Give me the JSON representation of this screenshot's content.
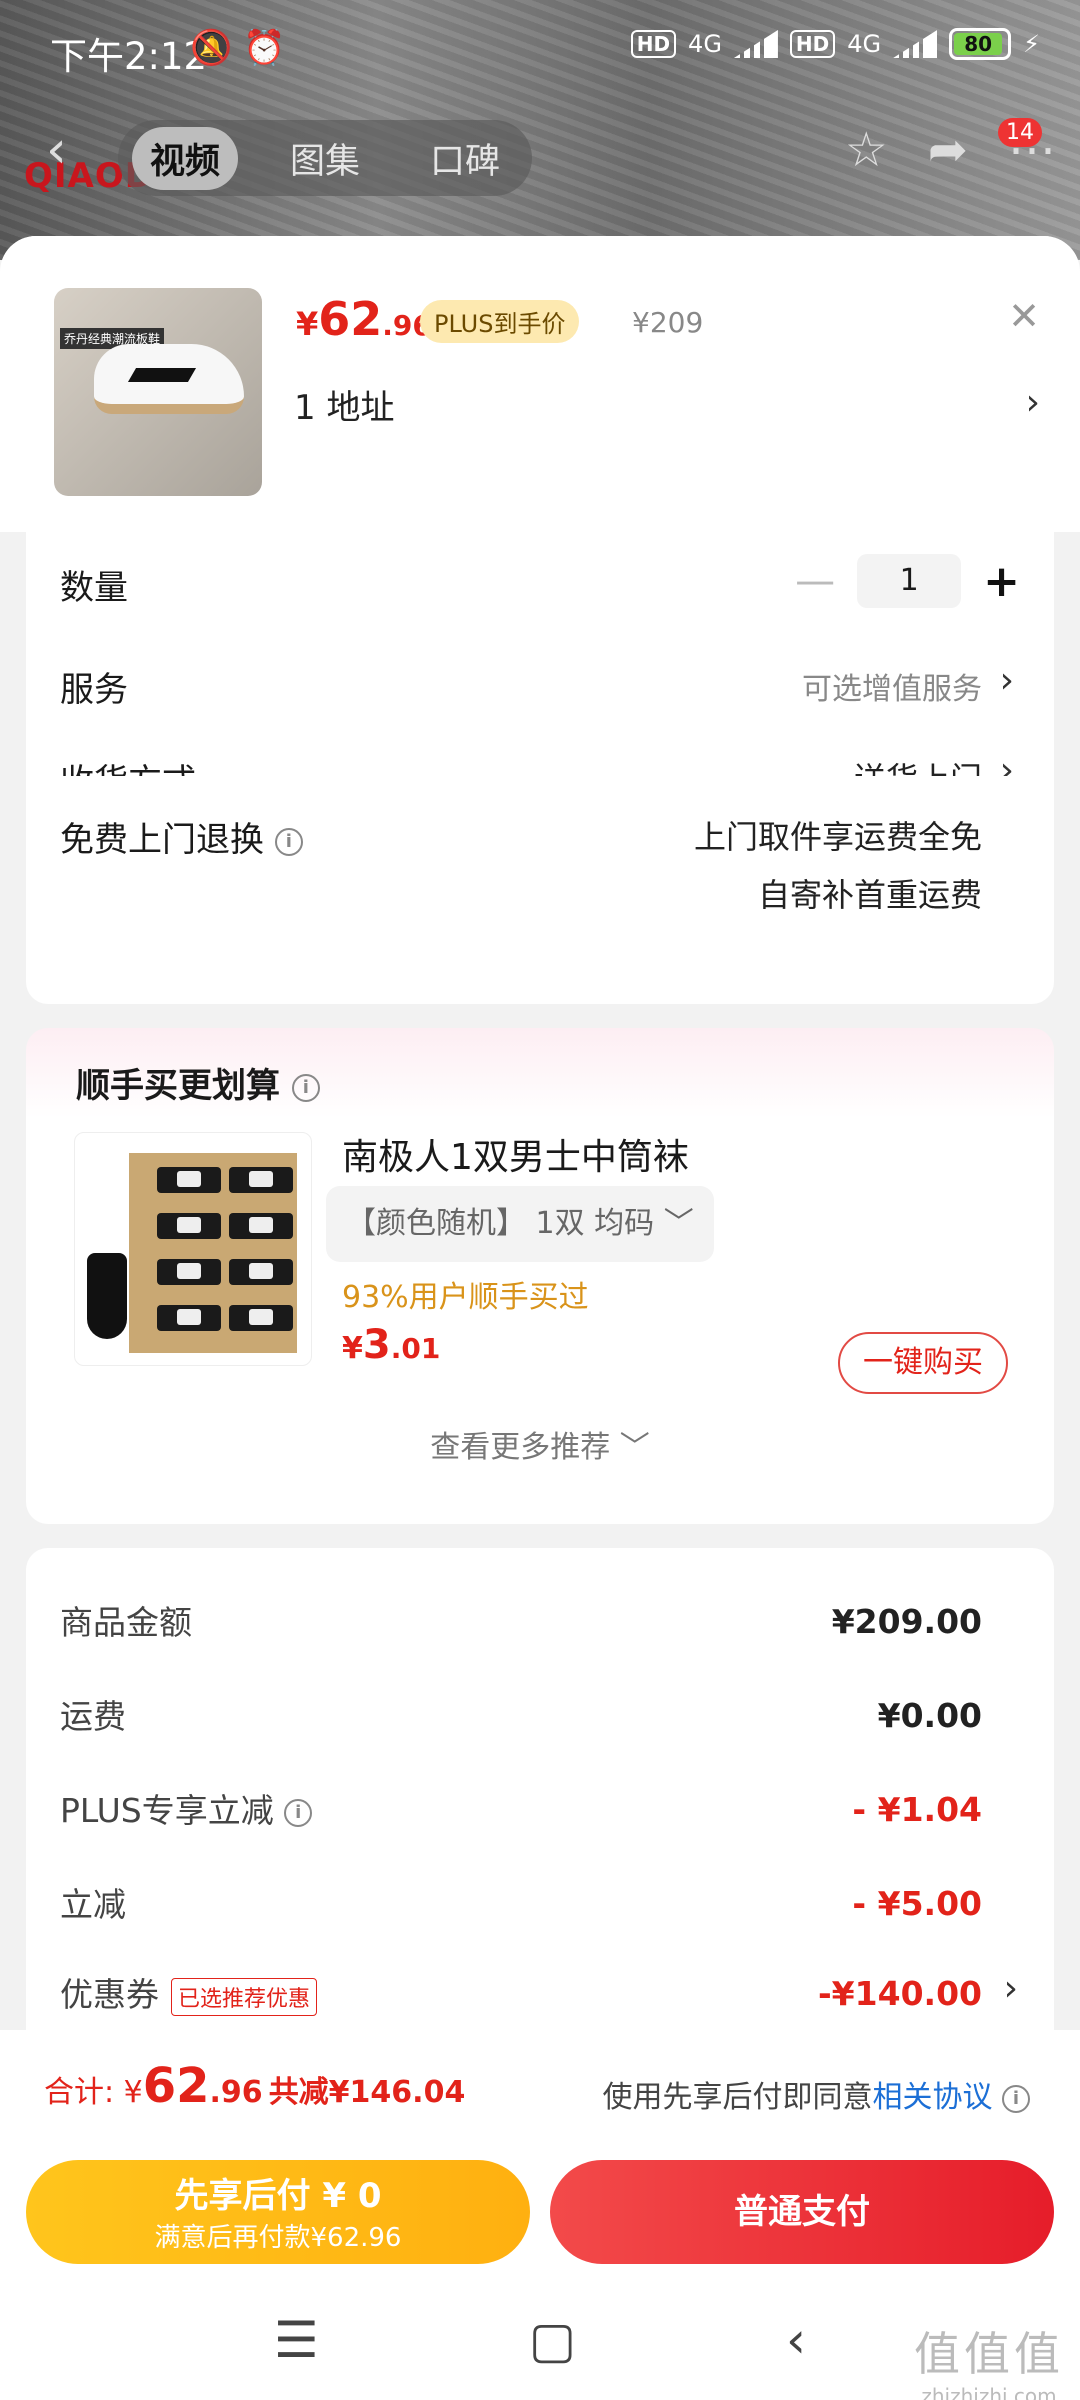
{
  "status_bar": {
    "time": "下午2:12",
    "net1": "4G",
    "hd1": "HD",
    "net2": "4G",
    "hd2": "HD",
    "battery": "80"
  },
  "top_nav": {
    "logo": "QIAODAN",
    "tabs": [
      "视频",
      "图集",
      "口碑"
    ],
    "active_tab": 0,
    "badge": "14"
  },
  "product": {
    "price_symbol": "¥",
    "price_int": "62",
    "price_dec": ".96",
    "plus_tag": "PLUS到手价",
    "original_price": "¥209",
    "address": "1  地址",
    "thumb_tag": "乔丹经典潮流板鞋"
  },
  "options": {
    "quantity_label": "数量",
    "quantity": "1",
    "service_label": "服务",
    "service_value": "可选增值服务",
    "delivery_label": "收货方式",
    "delivery_value": "送货上门",
    "return_label": "免费上门退换",
    "return_line1": "上门取件享运费全免",
    "return_line2": "自寄补首重运费"
  },
  "recommend": {
    "header": "顺手买更划算",
    "title": "南极人1双男士中筒袜",
    "variant": "【颜色随机】 1双    均码 ﹀",
    "percent": "93%用户顺手买过",
    "price_symbol": "¥",
    "price_int": "3",
    "price_dec": ".01",
    "buy_button": "一键购买",
    "more": "查看更多推荐 ﹀"
  },
  "breakdown": {
    "goods_label": "商品金额",
    "goods_value": "¥209.00",
    "shipping_label": "运费",
    "shipping_value": "¥0.00",
    "plus_label": "PLUS专享立减",
    "plus_value": "- ¥1.04",
    "discount_label": "立减",
    "discount_value": "- ¥5.00",
    "coupon_label": "优惠券",
    "coupon_tag": "已选推荐优惠",
    "coupon_value": "-¥140.00"
  },
  "footer": {
    "total_label": "合计: ¥",
    "total_int": "62",
    "total_dec": ".96",
    "saved": "共减¥146.04",
    "agree_text": "使用先享后付即同意",
    "agree_link": "相关协议",
    "later_line1": "先享后付 ¥ 0",
    "later_line2": "满意后再付款¥62.96",
    "pay_button": "普通支付"
  },
  "watermark": {
    "main": "值值值",
    "sub": "zhizhizhi.com"
  },
  "colors": {
    "accent_red": "#e2231a",
    "plus_gold": "#fde9b0",
    "later_yellow": "#ffb010",
    "link_blue": "#1c6fd6"
  }
}
